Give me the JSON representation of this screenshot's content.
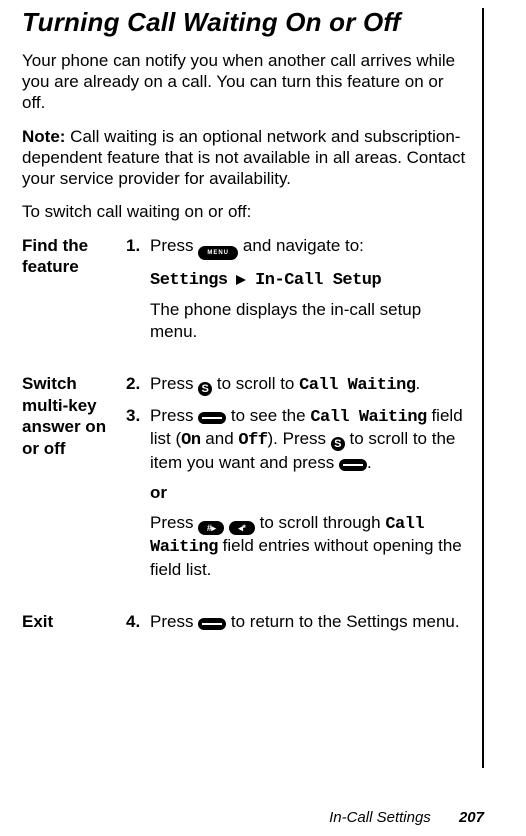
{
  "title": "Turning Call Waiting On or Off",
  "intro": "Your phone can notify you when another call arrives while you are already on a call. You can turn this feature on or off.",
  "note_lead": "Note:",
  "note_body": " Call waiting is an optional network and subscription-dependent feature that is not available in all areas. Contact your service provider for availability.",
  "lead_in": "To switch call waiting on or off:",
  "row1": {
    "label": "Find the feature",
    "num": "1.",
    "press": "Press ",
    "navigate": " and navigate to:",
    "menu_key": "MENU",
    "path_a": "Settings",
    "path_b": "In-Call Setup",
    "result": "The phone displays the in-call setup menu."
  },
  "row2": {
    "label": "Switch multi-key answer on or off",
    "num2": "2.",
    "s2_a": "Press ",
    "s2_b": " to scroll to ",
    "s2_c": "Call Waiting",
    "s2_d": ".",
    "num3": "3.",
    "s3_a": "Press ",
    "s3_b": " to see the ",
    "s3_c": "Call Waiting",
    "s3_d": " field list (",
    "s3_on": "On",
    "s3_and": " and ",
    "s3_off": "Off",
    "s3_e": "). Press ",
    "s3_f": " to scroll to the item you want and press ",
    "s3_g": ".",
    "or": "or",
    "alt_a": "Press ",
    "alt_pound": "#▸",
    "alt_star": "◂*",
    "alt_b": " to scroll through ",
    "alt_c": "Call Waiting",
    "alt_d": " field entries without opening the field list."
  },
  "row3": {
    "label": "Exit",
    "num": "4.",
    "a": "Press ",
    "b": " to return to the Settings menu."
  },
  "footer": {
    "section": "In-Call Settings",
    "page": "207"
  },
  "icons": {
    "scroll": "S"
  }
}
